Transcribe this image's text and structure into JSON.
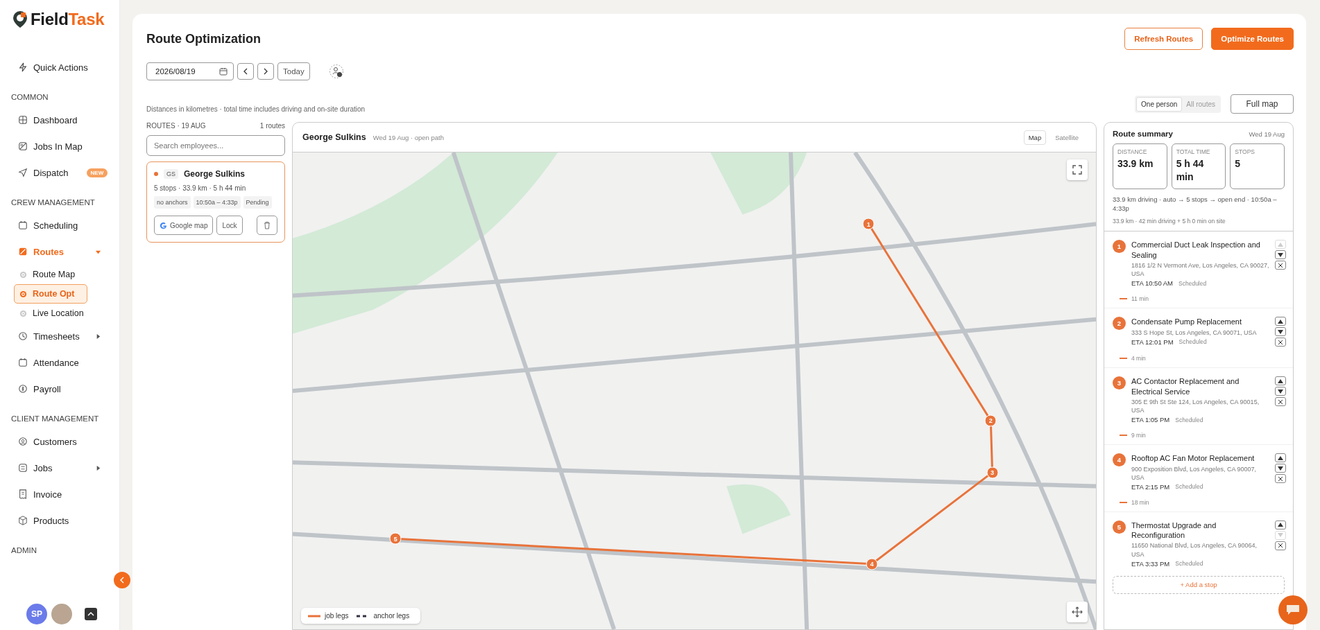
{
  "sidebar": {
    "brand_parts": [
      "Field",
      "Task"
    ],
    "quick_action": {
      "label": "Quick Actions"
    },
    "sections": [
      {
        "heading": "COMMON",
        "items": [
          {
            "label": "Dashboard",
            "selected": false
          },
          {
            "label": "Jobs In Map",
            "selected": false
          },
          {
            "label": "Dispatch",
            "selected": false,
            "badge": "NEW"
          }
        ]
      },
      {
        "heading": "CREW MANAGEMENT",
        "items": [
          {
            "label": "Scheduling",
            "selected": false
          },
          {
            "label": "Routes",
            "selected": true,
            "expanded": true,
            "children": [
              {
                "label": "Route Map",
                "selected": false
              },
              {
                "label": "Route Opt",
                "selected": true
              },
              {
                "label": "Live Location",
                "selected": false
              }
            ]
          },
          {
            "label": "Timesheets",
            "selected": false,
            "expanded": false
          },
          {
            "label": "Attendance",
            "selected": false
          },
          {
            "label": "Payroll",
            "selected": false
          }
        ]
      },
      {
        "heading": "CLIENT MANAGEMENT",
        "items": [
          {
            "label": "Customers",
            "selected": false
          },
          {
            "label": "Jobs",
            "selected": false,
            "expanded": false
          },
          {
            "label": "Invoice",
            "selected": false
          },
          {
            "label": "Products",
            "selected": false
          }
        ]
      },
      {
        "heading": "ADMIN"
      }
    ],
    "user": {
      "initials": "SP"
    }
  },
  "header": {
    "title": "Route Optimization",
    "buttons": [
      {
        "label": "Refresh Routes",
        "kind": "outline"
      },
      {
        "label": "Optimize Routes",
        "kind": "primary"
      }
    ]
  },
  "toolbar": {
    "date": "2026/08/19",
    "today": "Today"
  },
  "note": "Distances in kilometres · total time includes driving and on-site duration",
  "view_toggle": [
    {
      "label": "One person",
      "selected": true
    },
    {
      "label": "All routes",
      "selected": false
    }
  ],
  "full_map": "Full map",
  "routes_panel": {
    "heading": "ROUTES · 19 AUG",
    "count": "1 routes",
    "search": {
      "placeholder": "Search employees..."
    },
    "routes": [
      {
        "selected": true,
        "color": "#e8733a",
        "initials": "GS",
        "name": "George Sulkins",
        "summary": "5 stops · 33.9 km · 5 h 44 min",
        "tags": [
          "no anchors",
          "10:50a – 4:33p",
          "Pending"
        ],
        "buttons": [
          "Google map",
          "Lock"
        ]
      }
    ]
  },
  "map_panel": {
    "name": "George Sulkins",
    "subtitle": "Wed 19 Aug · open path",
    "tabs": [
      {
        "label": "Map",
        "selected": true
      },
      {
        "label": "Satellite",
        "selected": false
      }
    ],
    "markers": [
      {
        "label": "1"
      },
      {
        "label": "2"
      },
      {
        "label": "3"
      },
      {
        "label": "4"
      },
      {
        "label": "5"
      }
    ],
    "legend": [
      {
        "label": "job legs",
        "kind": "solid"
      },
      {
        "label": "anchor legs",
        "kind": "dashed"
      }
    ]
  },
  "summary": {
    "title": "Route summary",
    "date": "Wed 19 Aug",
    "stats": [
      {
        "label": "DISTANCE",
        "value": "33.9 km"
      },
      {
        "label": "TOTAL TIME",
        "value": "5 h 44 min"
      },
      {
        "label": "STOPS",
        "value": "5"
      }
    ],
    "lines": [
      "33.9 km driving · auto → 5 stops → open end · 10:50a – 4:33p",
      "33.9 km · 42 min driving + 5 h 0 min on site"
    ],
    "stops": [
      {
        "number": "1",
        "title": "Commercial Duct Leak Inspection and Sealing",
        "address": "1816 1/2 N Vermont Ave, Los Angeles, CA 90027, USA",
        "eta": "ETA 10:50 AM",
        "status": "Scheduled",
        "leg": "11 min",
        "up_disabled": true,
        "down_disabled": false
      },
      {
        "number": "2",
        "title": "Condensate Pump Replacement",
        "address": "333 S Hope St, Los Angeles, CA 90071, USA",
        "eta": "ETA 12:01 PM",
        "status": "Scheduled",
        "leg": "4 min",
        "up_disabled": false,
        "down_disabled": false
      },
      {
        "number": "3",
        "title": "AC Contactor Replacement and Electrical Service",
        "address": "305 E 9th St Ste 124, Los Angeles, CA 90015, USA",
        "eta": "ETA 1:05 PM",
        "status": "Scheduled",
        "leg": "9 min",
        "up_disabled": false,
        "down_disabled": false
      },
      {
        "number": "4",
        "title": "Rooftop AC Fan Motor Replacement",
        "address": "900 Exposition Blvd, Los Angeles, CA 90007, USA",
        "eta": "ETA 2:15 PM",
        "status": "Scheduled",
        "leg": "18 min",
        "up_disabled": false,
        "down_disabled": false
      },
      {
        "number": "5",
        "title": "Thermostat Upgrade and Reconfiguration",
        "address": "11650 National Blvd, Los Angeles, CA 90064, USA",
        "eta": "ETA 3:33 PM",
        "status": "Scheduled",
        "up_disabled": false,
        "down_disabled": true
      }
    ],
    "add_stop": "+ Add a stop"
  }
}
